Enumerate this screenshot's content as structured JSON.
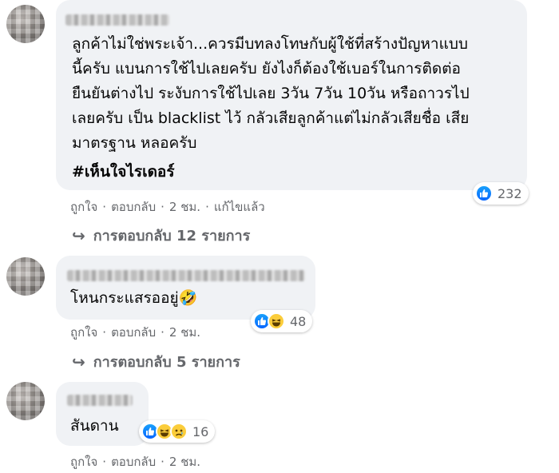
{
  "comments": [
    {
      "text": "ลูกค้าไม่ใช่พระเจ้า...ควรมีบทลงโทษกับผู้ใช้ที่สร้างปัญหาแบบ\nนี้ครับ แบนการใช้ไปเลยครับ ยังไงก็ต้องใช้เบอร์ในการติดต่อ\nยืนยันต่างไป ระงับการใช้ไปเลย 3วัน 7วัน 10วัน หรือถาวรไป\nเลยครับ เป็น blacklist ไว้ กลัวเสียลูกค้าแต่ไม่กลัวเสียชื่อ เสีย\nมาตรฐาน หลอครับ",
      "hashtag": "#เห็นใจไรเดอร์",
      "reaction_count": "232",
      "actions": {
        "like": "ถูกใจ",
        "reply": "ตอบกลับ",
        "time": "2 ชม.",
        "edited": "แก้ไขแล้ว"
      },
      "replies": "การตอบกลับ 12 รายการ"
    },
    {
      "text": "โหนกระแสรออยู่🤣",
      "reaction_count": "48",
      "actions": {
        "like": "ถูกใจ",
        "reply": "ตอบกลับ",
        "time": "2 ชม."
      },
      "replies": "การตอบกลับ 5 รายการ"
    },
    {
      "text": "สันดาน",
      "reaction_count": "16",
      "actions": {
        "like": "ถูกใจ",
        "reply": "ตอบกลับ",
        "time": "2 ชม."
      }
    }
  ],
  "separator": "·",
  "reply_arrow": "↪",
  "colors": {
    "bubble": "#f0f2f5",
    "meta": "#65676b",
    "like_blue": "#0866ff",
    "haha_yellow": "#fbcd3b"
  }
}
